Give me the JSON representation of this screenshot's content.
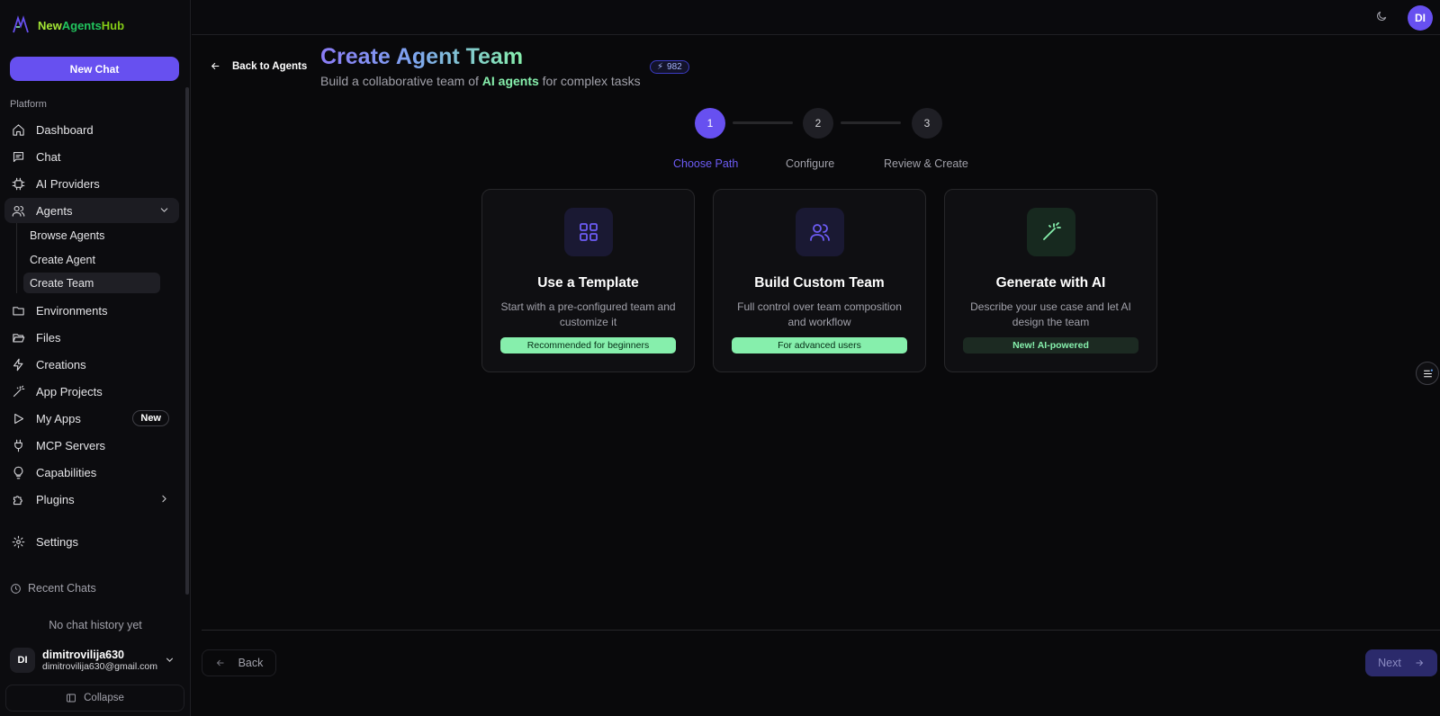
{
  "brand": {
    "part1": "New",
    "part2": "Agents",
    "part3": "Hub"
  },
  "sidebar": {
    "new_chat": "New Chat",
    "section": "Platform",
    "items": [
      {
        "label": "Dashboard",
        "icon": "home-icon"
      },
      {
        "label": "Chat",
        "icon": "chat-icon"
      },
      {
        "label": "AI Providers",
        "icon": "chip-icon"
      },
      {
        "label": "Agents",
        "icon": "users-icon"
      },
      {
        "label": "Environments",
        "icon": "folder-icon"
      },
      {
        "label": "Files",
        "icon": "folder-open-icon"
      },
      {
        "label": "Creations",
        "icon": "bolt-icon"
      },
      {
        "label": "App Projects",
        "icon": "wand-icon"
      },
      {
        "label": "My Apps",
        "icon": "play-icon",
        "badge": "New"
      },
      {
        "label": "MCP Servers",
        "icon": "plug-icon"
      },
      {
        "label": "Capabilities",
        "icon": "bulb-icon"
      },
      {
        "label": "Plugins",
        "icon": "puzzle-icon"
      },
      {
        "label": "Settings",
        "icon": "gear-icon"
      }
    ],
    "agents_sub": [
      "Browse Agents",
      "Create Agent",
      "Create Team"
    ],
    "recent_label": "Recent Chats",
    "no_history": "No chat history yet",
    "user": {
      "initials": "DI",
      "name": "dimitrovilija630",
      "email": "dimitrovilija630@gmail.com"
    },
    "collapse": "Collapse"
  },
  "topbar": {
    "avatar": "DI"
  },
  "header": {
    "back": "Back to Agents",
    "title": "Create Agent Team",
    "subtitle_pre": "Build a collaborative team of ",
    "subtitle_hl": "AI agents",
    "subtitle_post": " for complex tasks",
    "credits": "982"
  },
  "steps": [
    {
      "num": "1",
      "label": "Choose Path"
    },
    {
      "num": "2",
      "label": "Configure"
    },
    {
      "num": "3",
      "label": "Review & Create"
    }
  ],
  "cards": [
    {
      "title": "Use a Template",
      "desc": "Start with a pre-configured team and customize it",
      "tag": "Recommended for beginners",
      "icon": "grid-icon"
    },
    {
      "title": "Build Custom Team",
      "desc": "Full control over team composition and workflow",
      "tag": "For advanced users",
      "icon": "users-icon"
    },
    {
      "title": "Generate with AI",
      "desc": "Describe your use case and let AI design the team",
      "tag": "New! AI-powered",
      "icon": "wand-icon"
    }
  ],
  "footer": {
    "back": "Back",
    "next": "Next"
  },
  "colors": {
    "accent": "#6750f0",
    "green": "#86efac",
    "background": "#09090b"
  }
}
